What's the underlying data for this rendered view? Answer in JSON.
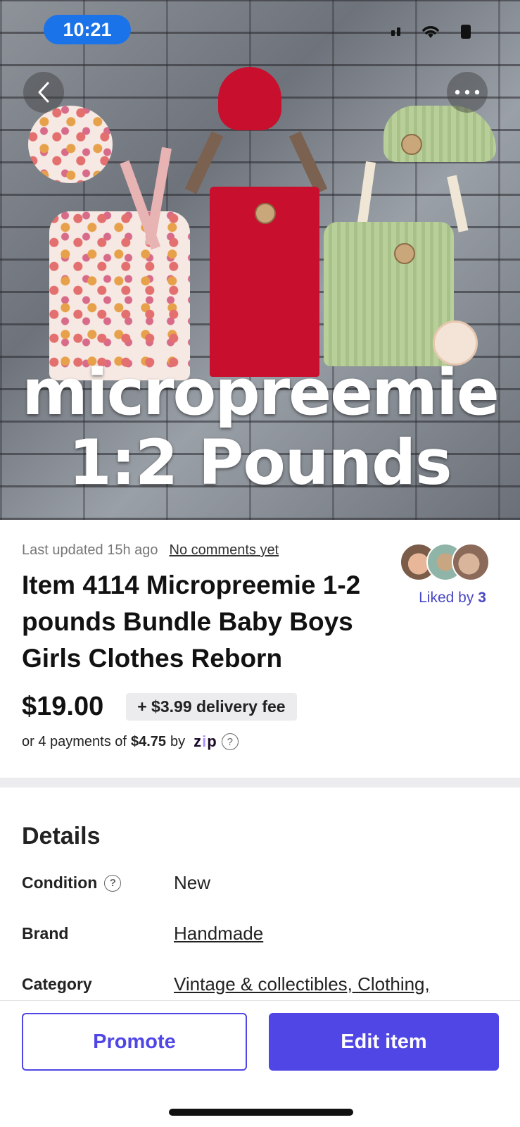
{
  "status_bar": {
    "time": "10:21"
  },
  "hero": {
    "overlay_line_1": "micropreemie",
    "overlay_line_2": "1:2 Pounds"
  },
  "listing": {
    "last_updated": "Last updated 15h ago",
    "comments_link": "No comments yet",
    "title": "Item 4114 Micropreemie 1-2 pounds Bundle Baby Boys Girls Clothes Reborn",
    "liked_prefix": "Liked by",
    "liked_count": "3",
    "price": "$19.00",
    "delivery_fee": "+ $3.99 delivery fee",
    "installments_prefix": "or 4 payments of",
    "installments_amount": "$4.75",
    "installments_by": "by",
    "installments_provider": "zip"
  },
  "details": {
    "heading": "Details",
    "rows": [
      {
        "label": "Condition",
        "value": "New"
      },
      {
        "label": "Brand",
        "value": "Handmade"
      },
      {
        "label": "Category",
        "value": "Vintage & collectibles, Clothing,"
      }
    ]
  },
  "actions": {
    "promote": "Promote",
    "edit": "Edit item"
  },
  "colors": {
    "accent": "#5046e5",
    "liked_text": "#4a47c4",
    "status_pill": "#1a73e8"
  },
  "icons": [
    "back-arrow-icon",
    "more-dots-icon",
    "signal-icon",
    "wifi-icon",
    "battery-icon",
    "help-circle-icon"
  ]
}
